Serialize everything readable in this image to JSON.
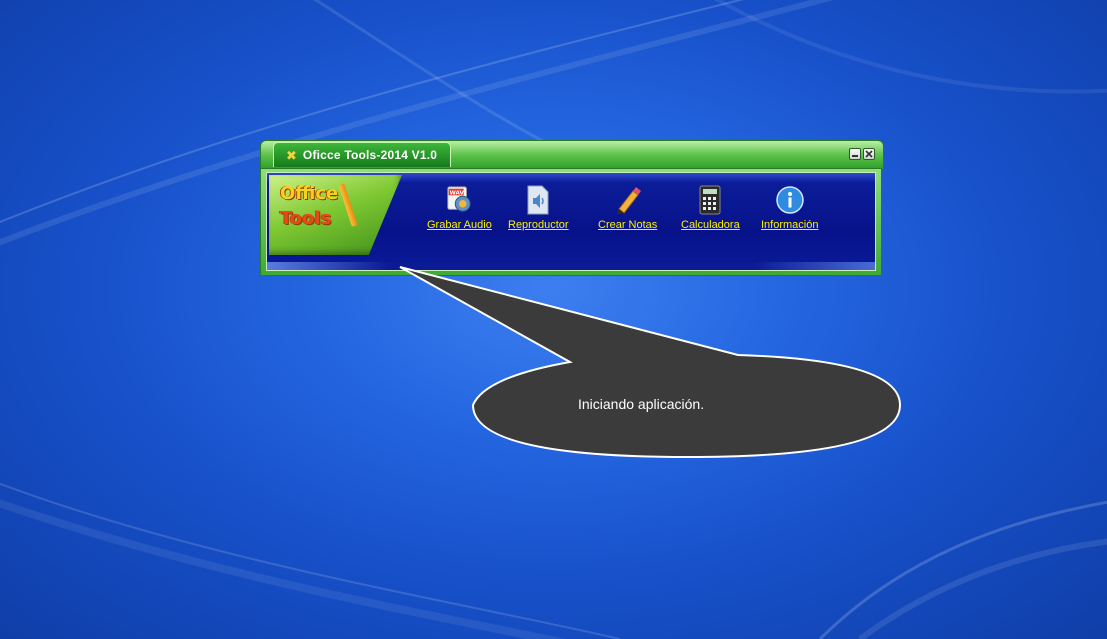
{
  "window": {
    "title": "Oficce Tools-2014  V1.0",
    "minimize_label": "",
    "close_label": "x"
  },
  "logo": {
    "line1": "Office",
    "line2": "Tools"
  },
  "tools": [
    {
      "label": "Grabar Audio",
      "icon": "record-audio-icon"
    },
    {
      "label": "Reproductor",
      "icon": "player-icon"
    },
    {
      "label": "Crear Notas",
      "icon": "pencil-icon"
    },
    {
      "label": "Calculadora",
      "icon": "calculator-icon"
    },
    {
      "label": "Información",
      "icon": "info-icon"
    }
  ],
  "balloon": {
    "message": "Iniciando aplicación."
  },
  "colors": {
    "desktop": "#1f5fd8",
    "titlebar_green": "#3eb63a",
    "panel_blue": "#0b1b93",
    "link_yellow": "#fff200",
    "balloon_fill": "#3b3b3b"
  }
}
